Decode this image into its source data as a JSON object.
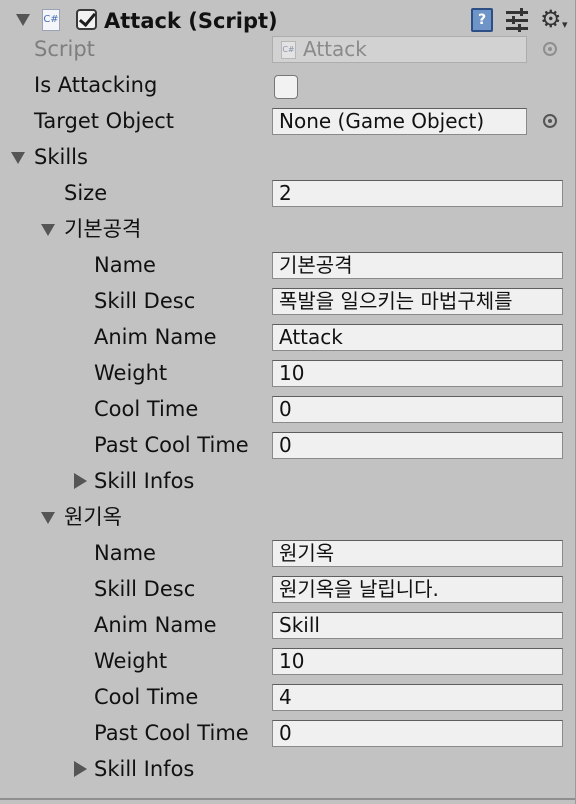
{
  "component": {
    "title": "Attack (Script)",
    "script_label": "Script",
    "script_value": "Attack",
    "is_attacking_label": "Is Attacking",
    "is_attacking": false,
    "target_label": "Target Object",
    "target_value": "None (Game Object)",
    "icons": [
      "csharp-script-icon",
      "help-book-icon",
      "presets-sliders-icon",
      "gear-icon"
    ]
  },
  "skills": {
    "label": "Skills",
    "size_label": "Size",
    "size": "2",
    "elements": [
      {
        "header": "기본공격",
        "name_label": "Name",
        "name": "기본공격",
        "desc_label": "Skill Desc",
        "desc": "폭발을 일으키는 마법구체를",
        "anim_label": "Anim Name",
        "anim": "Attack",
        "weight_label": "Weight",
        "weight": "10",
        "cool_label": "Cool Time",
        "cool": "0",
        "past_label": "Past Cool Time",
        "past": "0",
        "infos_label": "Skill Infos"
      },
      {
        "header": "원기옥",
        "name_label": "Name",
        "name": "원기옥",
        "desc_label": "Skill Desc",
        "desc": "원기옥을 날립니다.",
        "anim_label": "Anim Name",
        "anim": "Skill",
        "weight_label": "Weight",
        "weight": "10",
        "cool_label": "Cool Time",
        "cool": "4",
        "past_label": "Past Cool Time",
        "past": "0",
        "infos_label": "Skill Infos"
      }
    ]
  }
}
